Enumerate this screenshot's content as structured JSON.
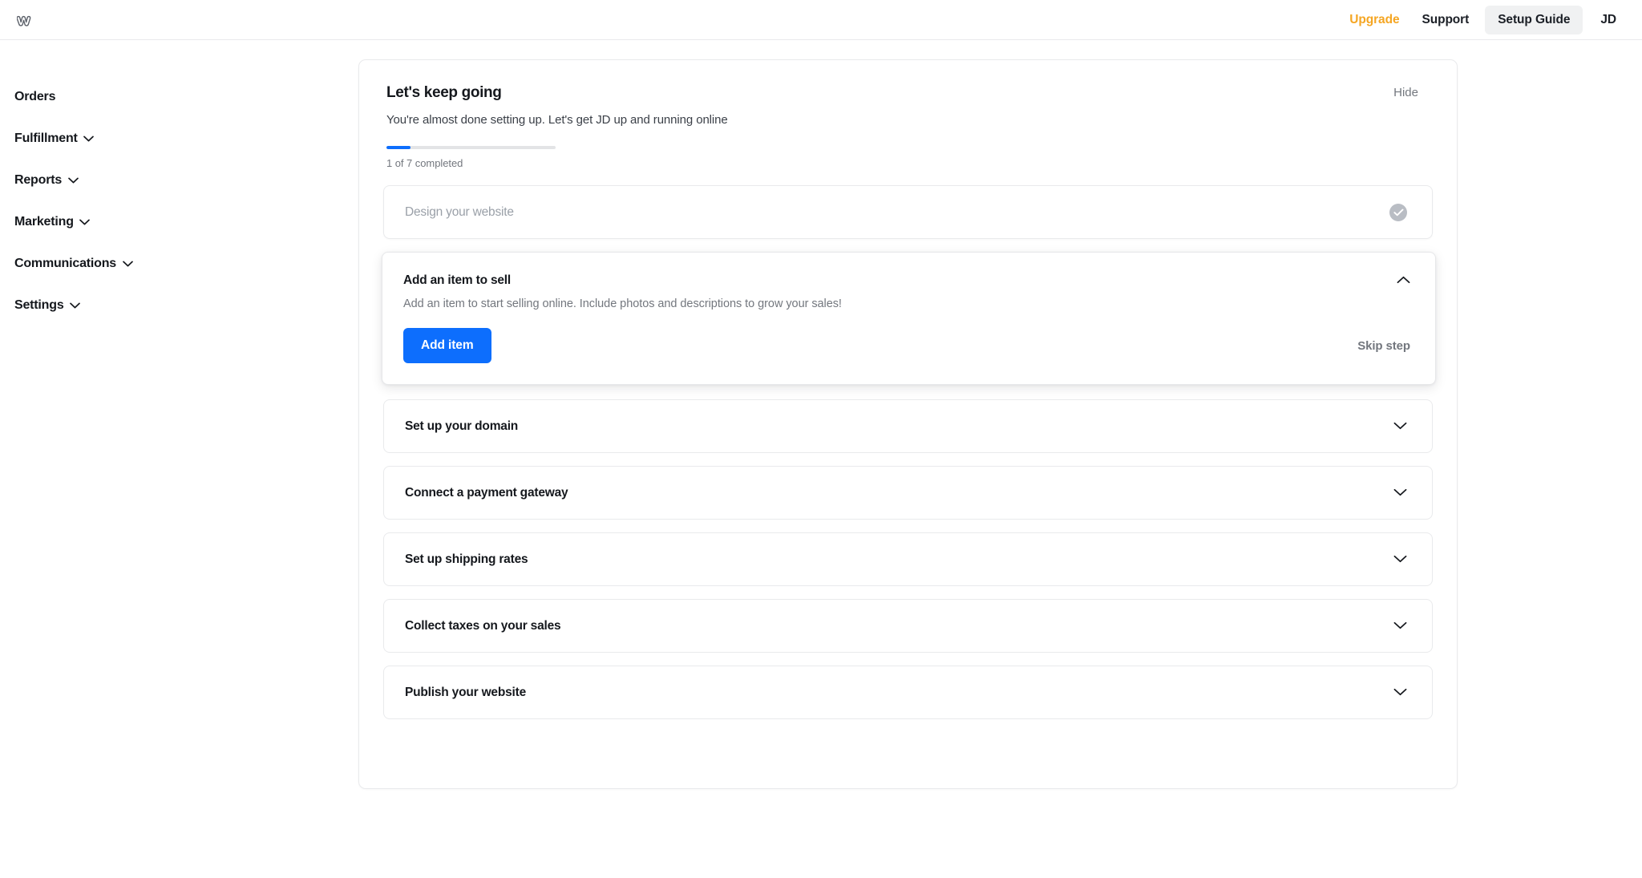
{
  "header": {
    "logo_icon": "weebly-w-logo-icon",
    "upgrade_label": "Upgrade",
    "support_label": "Support",
    "setup_guide_label": "Setup Guide",
    "avatar_initials": "JD",
    "accent_upgrade_color": "#f5a623",
    "pill_background": "#f0f1f2"
  },
  "sidebar": {
    "items": [
      {
        "label": "Orders",
        "has_chevron": false
      },
      {
        "label": "Fulfillment",
        "has_chevron": true
      },
      {
        "label": "Reports",
        "has_chevron": true
      },
      {
        "label": "Marketing",
        "has_chevron": true
      },
      {
        "label": "Communications",
        "has_chevron": true
      },
      {
        "label": "Settings",
        "has_chevron": true
      }
    ],
    "chevron_icon": "chevron-down-icon"
  },
  "guide": {
    "title": "Let's keep going",
    "hide_label": "Hide",
    "subtitle": "You're almost done setting up. Let's get JD up and running online",
    "progress": {
      "completed": 1,
      "total": 7,
      "percent": 14,
      "label": "1 of 7 completed",
      "fill_color": "#0d6efd",
      "track_color": "#e3e4e6"
    },
    "steps": [
      {
        "title": "Design your website",
        "state": "completed",
        "status_icon": "check-circle-icon"
      },
      {
        "title": "Add an item to sell",
        "state": "expanded",
        "toggle_icon": "chevron-up-icon",
        "description": "Add an item to start selling online. Include photos and descriptions to grow your sales!",
        "primary_button": "Add item",
        "skip_label": "Skip step",
        "primary_button_color": "#0d6efd"
      },
      {
        "title": "Set up your domain",
        "state": "collapsed",
        "toggle_icon": "chevron-down-icon"
      },
      {
        "title": "Connect a payment gateway",
        "state": "collapsed",
        "toggle_icon": "chevron-down-icon"
      },
      {
        "title": "Set up shipping rates",
        "state": "collapsed",
        "toggle_icon": "chevron-down-icon"
      },
      {
        "title": "Collect taxes on your sales",
        "state": "collapsed",
        "toggle_icon": "chevron-down-icon"
      },
      {
        "title": "Publish your website",
        "state": "collapsed",
        "toggle_icon": "chevron-down-icon"
      }
    ]
  }
}
